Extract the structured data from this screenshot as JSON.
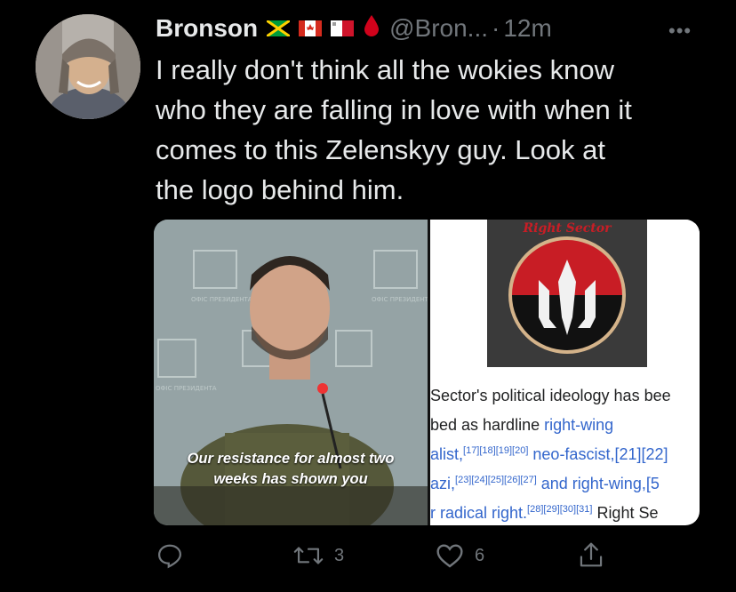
{
  "tweet": {
    "display_name": "Bronson",
    "handle": "@Bron...",
    "separator": "·",
    "time": "12m",
    "more_icon": "more-dots-icon",
    "text": "I really don't think all the wokies know\nwho they are falling in love with when it\ncomes to this Zelenskyy guy.  Look at\nthe logo behind him.",
    "flags": [
      "jamaica-flag",
      "canada-flag",
      "malta-flag",
      "blood-drop-emoji"
    ]
  },
  "media": {
    "left": {
      "caption_line1": "Our resistance for almost two",
      "caption_line2": "weeks has shown you",
      "wall_text": "ОФІС ПРЕЗИДЕНТА УКРАЇНИ"
    },
    "right": {
      "banner_text": "Right Sector",
      "lines": [
        {
          "pre": "Sector's political ideology has bee",
          "link": "",
          "sup": "",
          "post": ""
        },
        {
          "pre": "bed as hardline ",
          "link": "right-wing",
          "sup": "",
          "post": ""
        },
        {
          "pre": "",
          "link": "alist,",
          "sup": "[17][18][19][20]",
          "post": " neo-fascist,[21][22]"
        },
        {
          "pre": "",
          "link": "azi,",
          "sup": "[23][24][25][26][27]",
          "post": " and right-wing,[5"
        },
        {
          "pre": "",
          "link": "r radical right.",
          "sup": "[28][29][30][31]",
          "post": " Right Se"
        }
      ]
    }
  },
  "actions": {
    "reply_icon": "reply-icon",
    "retweet_icon": "retweet-icon",
    "retweet_count": "3",
    "like_icon": "heart-icon",
    "like_count": "6",
    "share_icon": "share-icon"
  },
  "colors": {
    "background": "#000000",
    "text": "#e7e9ea",
    "secondary": "#71767b",
    "wiki_link": "#3366cc"
  }
}
